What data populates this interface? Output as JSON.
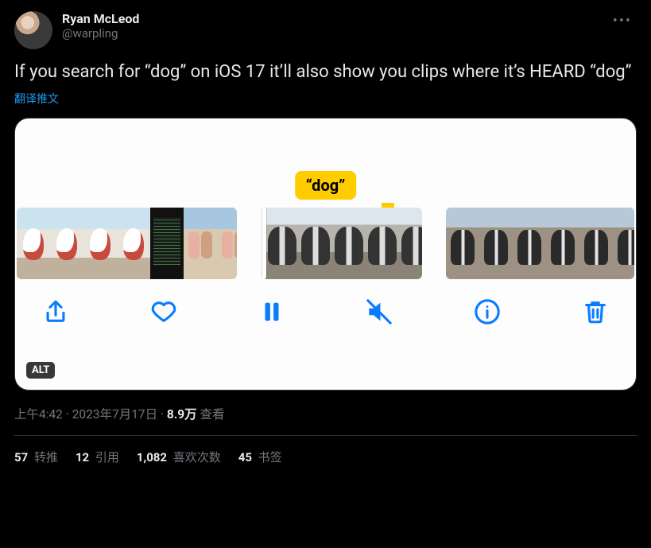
{
  "author": {
    "display_name": "Ryan McLeod",
    "handle": "@warpling"
  },
  "tweet_text": "If you search for “dog” on iOS 17 it’ll also show you clips where it’s HEARD “dog”",
  "translate_label": "翻译推文",
  "media": {
    "search_bubble": "“dog”",
    "alt_badge": "ALT",
    "toolbar_icons": {
      "share": "share-icon",
      "like": "heart-icon",
      "pause": "pause-icon",
      "mute": "volume-off-icon",
      "info": "info-icon",
      "trash": "trash-icon"
    }
  },
  "meta": {
    "time": "上午4:42",
    "sep": " · ",
    "date": "2023年7月17日",
    "views_value": "8.9万",
    "views_label": " 查看"
  },
  "stats": {
    "retweets": {
      "count": "57",
      "label": " 转推"
    },
    "quotes": {
      "count": "12",
      "label": " 引用"
    },
    "likes": {
      "count": "1,082",
      "label": " 喜欢次数"
    },
    "bookmarks": {
      "count": "45",
      "label": " 书签"
    }
  }
}
